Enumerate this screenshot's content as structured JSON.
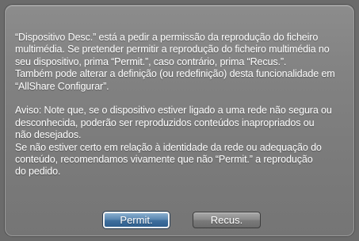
{
  "dialog": {
    "paragraphs": [
      "“Dispositivo Desc.” está a pedir a permissão da reprodução do ficheiro\nmultimédia. Se pretender permitir a reprodução do ficheiro multimédia no\nseu dispositivo, prima “Permit.”, caso contrário, prima “Recus.”.\nTambém pode alterar a definição (ou redefinição) desta funcionalidade em\n“AllShare Configurar”.",
      "Aviso: Note que, se o dispositivo estiver ligado a uma rede não segura ou\ndesconhecida, poderão ser reproduzidos conteúdos inapropriados ou\nnão desejados.\nSe não estiver certo em relação à identidade da rede ou adequação do\nconteúdo, recomendamos vivamente que não “Permit.” a reprodução\ndo pedido."
    ],
    "buttons": {
      "permit": "Permit.",
      "refuse": "Recus."
    }
  },
  "colors": {
    "background": "#6b6b6b",
    "dialog": "#828282",
    "text": "#ffffff",
    "focused_button": "#4a7aa8"
  }
}
